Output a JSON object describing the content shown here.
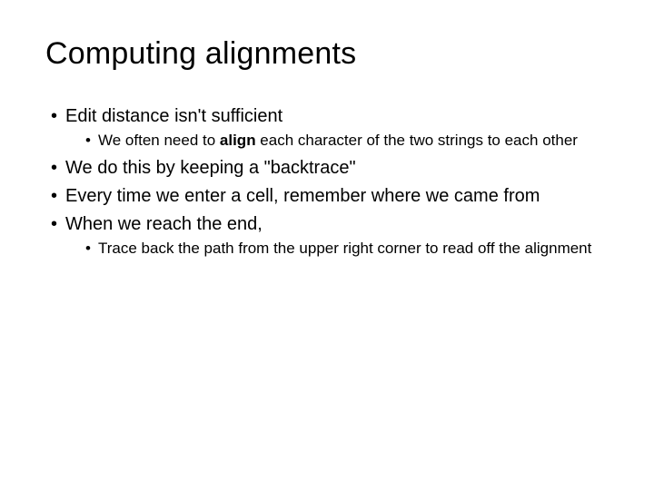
{
  "title": "Computing alignments",
  "bullets": {
    "b1": "Edit distance isn't sufficient",
    "b1_sub1_pre": "We often need to ",
    "b1_sub1_bold": "align",
    "b1_sub1_post": " each character of the two strings to each other",
    "b2": "We do this by keeping a \"backtrace\"",
    "b3": "Every time we enter a cell, remember where we came from",
    "b4": "When we reach the end,",
    "b4_sub1": "Trace back the path from the upper right corner to read off the alignment"
  }
}
